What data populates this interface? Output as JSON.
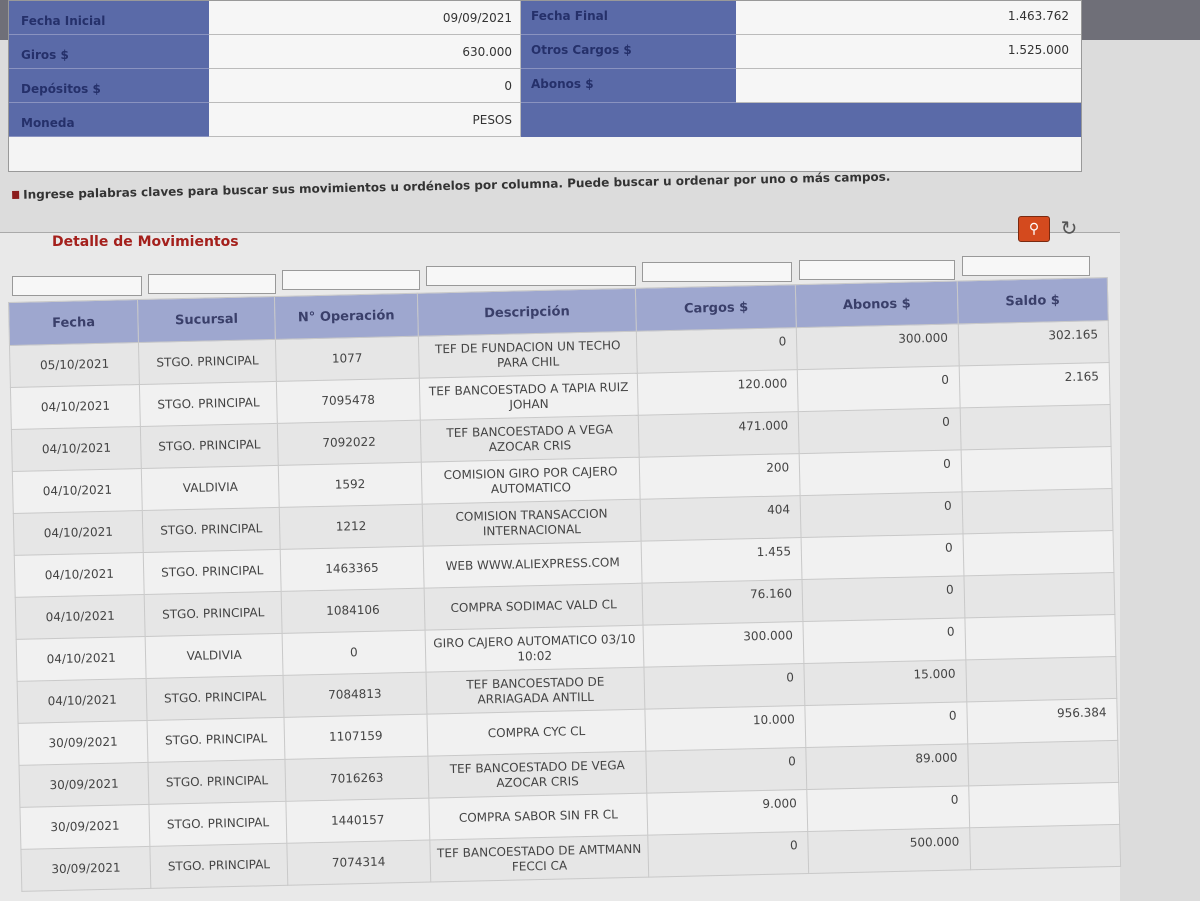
{
  "summary": {
    "rows": [
      {
        "label": "Fecha Inicial",
        "value": "09/09/2021",
        "label2": "Fecha Final",
        "value2": "1.463.762"
      },
      {
        "label": "Giros $",
        "value": "630.000",
        "label2": "Otros Cargos $",
        "value2": "1.525.000"
      },
      {
        "label": "Depósitos $",
        "value": "0",
        "label2": "Abonos $",
        "value2": ""
      },
      {
        "label": "Moneda",
        "value": "PESOS",
        "label2": "",
        "value2": ""
      }
    ]
  },
  "hint": "Ingrese palabras claves para buscar sus movimientos u ordénelos por columna. Puede buscar u ordenar por uno o más campos.",
  "panel": {
    "title": "Detalle de Movimientos",
    "search_icon": "search-icon",
    "refresh_icon": "refresh-icon"
  },
  "table": {
    "headers": [
      "Fecha",
      "Sucursal",
      "N° Operación",
      "Descripción",
      "Cargos $",
      "Abonos $",
      "Saldo $"
    ],
    "rows": [
      [
        "05/10/2021",
        "STGO. PRINCIPAL",
        "1077",
        "TEF DE FUNDACION UN TECHO PARA CHIL",
        "0",
        "300.000",
        "302.165"
      ],
      [
        "04/10/2021",
        "STGO. PRINCIPAL",
        "7095478",
        "TEF BANCOESTADO A TAPIA RUIZ JOHAN",
        "120.000",
        "0",
        "2.165"
      ],
      [
        "04/10/2021",
        "STGO. PRINCIPAL",
        "7092022",
        "TEF BANCOESTADO A VEGA AZOCAR CRIS",
        "471.000",
        "0",
        ""
      ],
      [
        "04/10/2021",
        "VALDIVIA",
        "1592",
        "COMISION GIRO POR CAJERO AUTOMATICO",
        "200",
        "0",
        ""
      ],
      [
        "04/10/2021",
        "STGO. PRINCIPAL",
        "1212",
        "COMISION TRANSACCION INTERNACIONAL",
        "404",
        "0",
        ""
      ],
      [
        "04/10/2021",
        "STGO. PRINCIPAL",
        "1463365",
        "WEB WWW.ALIEXPRESS.COM",
        "1.455",
        "0",
        ""
      ],
      [
        "04/10/2021",
        "STGO. PRINCIPAL",
        "1084106",
        "COMPRA SODIMAC VALD CL",
        "76.160",
        "0",
        ""
      ],
      [
        "04/10/2021",
        "VALDIVIA",
        "0",
        "GIRO CAJERO AUTOMATICO 03/10 10:02",
        "300.000",
        "0",
        ""
      ],
      [
        "04/10/2021",
        "STGO. PRINCIPAL",
        "7084813",
        "TEF BANCOESTADO DE ARRIAGADA ANTILL",
        "0",
        "15.000",
        ""
      ],
      [
        "30/09/2021",
        "STGO. PRINCIPAL",
        "1107159",
        "COMPRA CYC CL",
        "10.000",
        "0",
        "956.384"
      ],
      [
        "30/09/2021",
        "STGO. PRINCIPAL",
        "7016263",
        "TEF BANCOESTADO DE VEGA AZOCAR CRIS",
        "0",
        "89.000",
        ""
      ],
      [
        "30/09/2021",
        "STGO. PRINCIPAL",
        "1440157",
        "COMPRA SABOR SIN FR CL",
        "9.000",
        "0",
        ""
      ],
      [
        "30/09/2021",
        "STGO. PRINCIPAL",
        "7074314",
        "TEF BANCOESTADO DE AMTMANN FECCI CA",
        "0",
        "500.000",
        ""
      ]
    ]
  }
}
